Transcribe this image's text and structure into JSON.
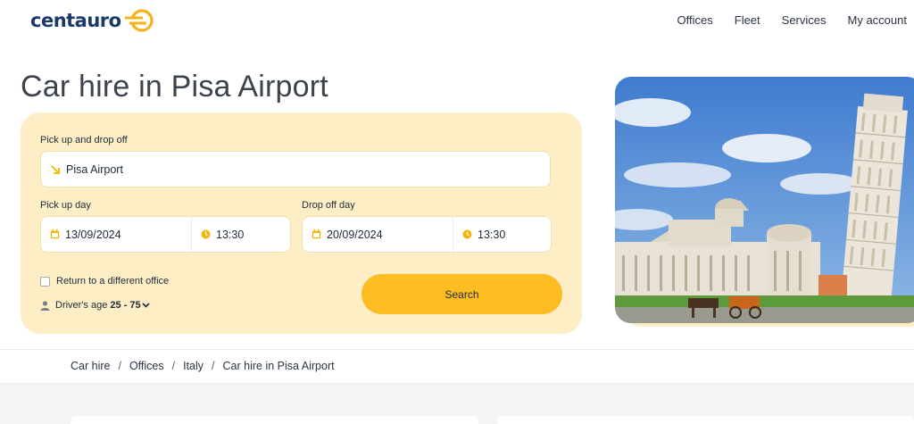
{
  "brand": {
    "name": "centauro"
  },
  "nav": [
    "Offices",
    "Fleet",
    "Services",
    "My account"
  ],
  "page": {
    "title": "Car hire in Pisa Airport"
  },
  "form": {
    "location_label": "Pick up and drop off",
    "location_value": "Pisa Airport",
    "pickup_label": "Pick up day",
    "pickup_date": "13/09/2024",
    "pickup_time": "13:30",
    "dropoff_label": "Drop off day",
    "dropoff_date": "20/09/2024",
    "dropoff_time": "13:30",
    "return_label": "Return to a different office",
    "age_label": "Driver's age",
    "age_value": "25 - 75",
    "search_label": "Search"
  },
  "breadcrumb": [
    "Car hire",
    "Offices",
    "Italy",
    "Car hire in Pisa Airport"
  ],
  "colors": {
    "accent": "#fcbc22",
    "card": "#fdeec6",
    "brand": "#1b3a6b"
  }
}
